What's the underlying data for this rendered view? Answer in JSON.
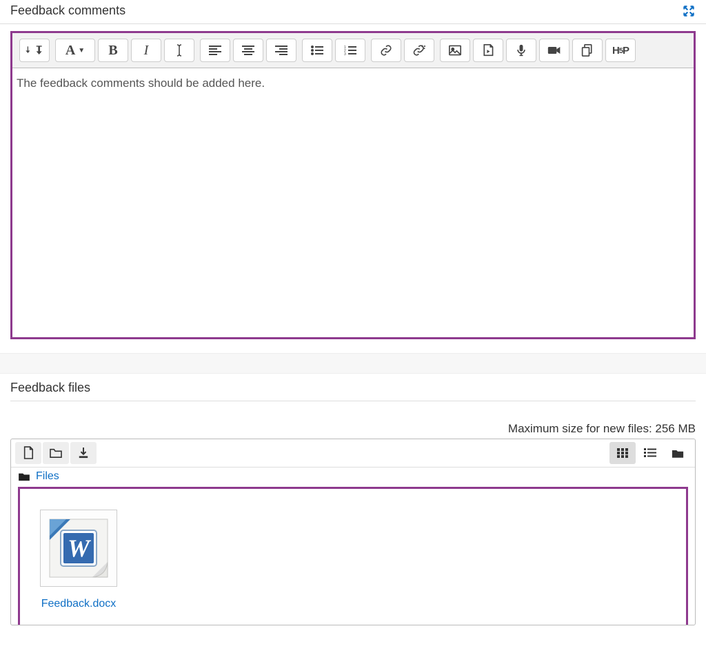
{
  "comments": {
    "title": "Feedback comments",
    "editor_text": "The feedback comments should be added here.",
    "toolbar": {
      "font_label": "A"
    }
  },
  "files": {
    "title": "Feedback files",
    "max_size_text": "Maximum size for new files: 256 MB",
    "breadcrumb_root": "Files",
    "items": [
      {
        "name": "Feedback.docx"
      }
    ]
  }
}
